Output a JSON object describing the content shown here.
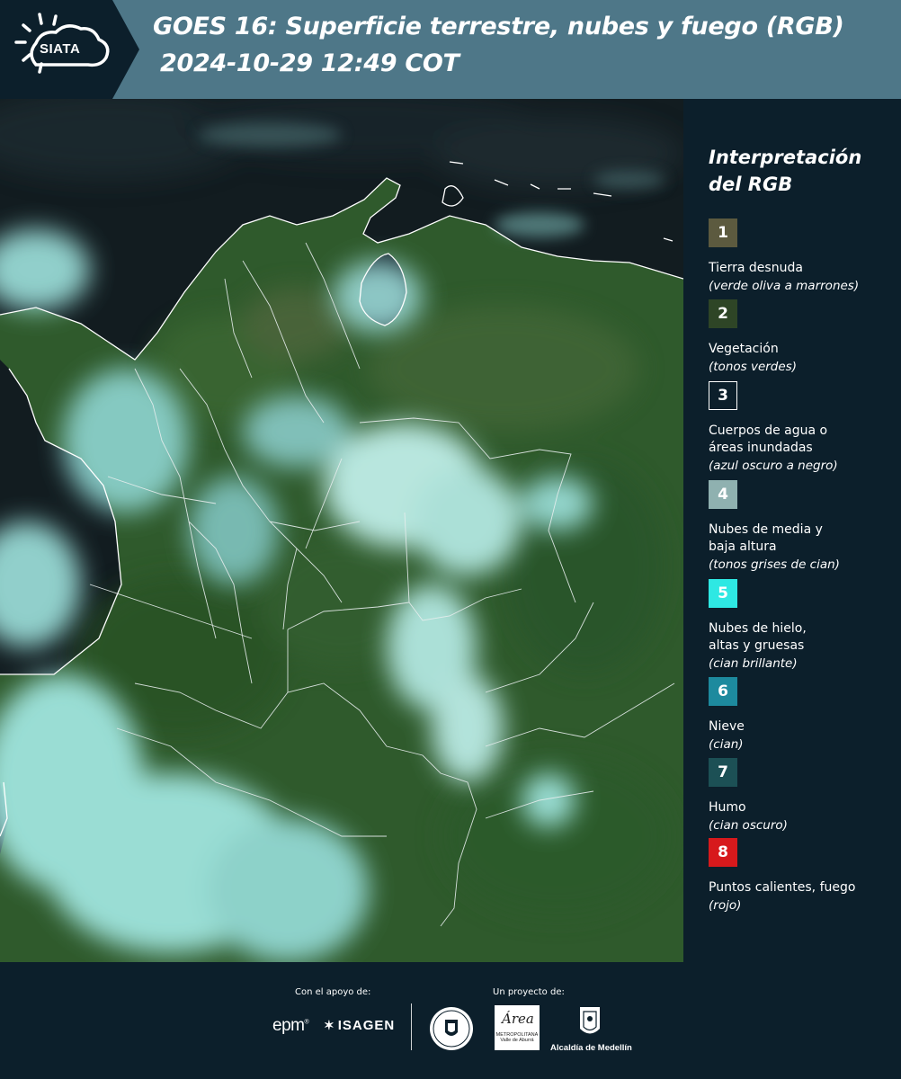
{
  "header": {
    "logo_text": "SIATA",
    "title_line1": "GOES 16: Superficie terrestre, nubes y fuego (RGB)",
    "title_line2": "2024-10-29 12:49 COT"
  },
  "legend": {
    "title": "Interpretación del RGB",
    "items": [
      {
        "number": "1",
        "label": "Tierra desnuda",
        "sub": "(verde oliva a marrones)",
        "color": "#5c5a3f"
      },
      {
        "number": "2",
        "label": "Vegetación",
        "sub": "(tonos verdes)",
        "color": "#2e4526"
      },
      {
        "number": "3",
        "label": "Cuerpos de agua o\náreas inundadas",
        "sub": "(azul oscuro a negro)",
        "color": "#0c1f2b"
      },
      {
        "number": "4",
        "label": "Nubes de media y\nbaja altura",
        "sub": "(tonos grises de cian)",
        "color": "#8fb1b0"
      },
      {
        "number": "5",
        "label": "Nubes de hielo,\naltas y gruesas",
        "sub": "(cian brillante)",
        "color": "#2ee8e3"
      },
      {
        "number": "6",
        "label": "Nieve",
        "sub": "(cian)",
        "color": "#1d8a9e"
      },
      {
        "number": "7",
        "label": "Humo",
        "sub": "(cian oscuro)",
        "color": "#1c5055"
      },
      {
        "number": "8",
        "label": "Puntos calientes, fuego",
        "sub": "(rojo)",
        "color": "#d7191c"
      }
    ]
  },
  "footer": {
    "support_label": "Con el apoyo de:",
    "project_label": "Un proyecto de:",
    "sponsor1": "epm",
    "sponsor2": "ISAGEN",
    "area_logo_text": "METROPOLITANA",
    "area_logo_sub": "Valle de Aburrá",
    "alcaldia": "Alcaldía de Medellín"
  },
  "colors": {
    "header_bg": "#4e7788",
    "panel_bg": "#0c1f2b",
    "vegetation": "#2f5a2c",
    "cloud": "#a6ece7",
    "sea": "#0f1a1f"
  }
}
